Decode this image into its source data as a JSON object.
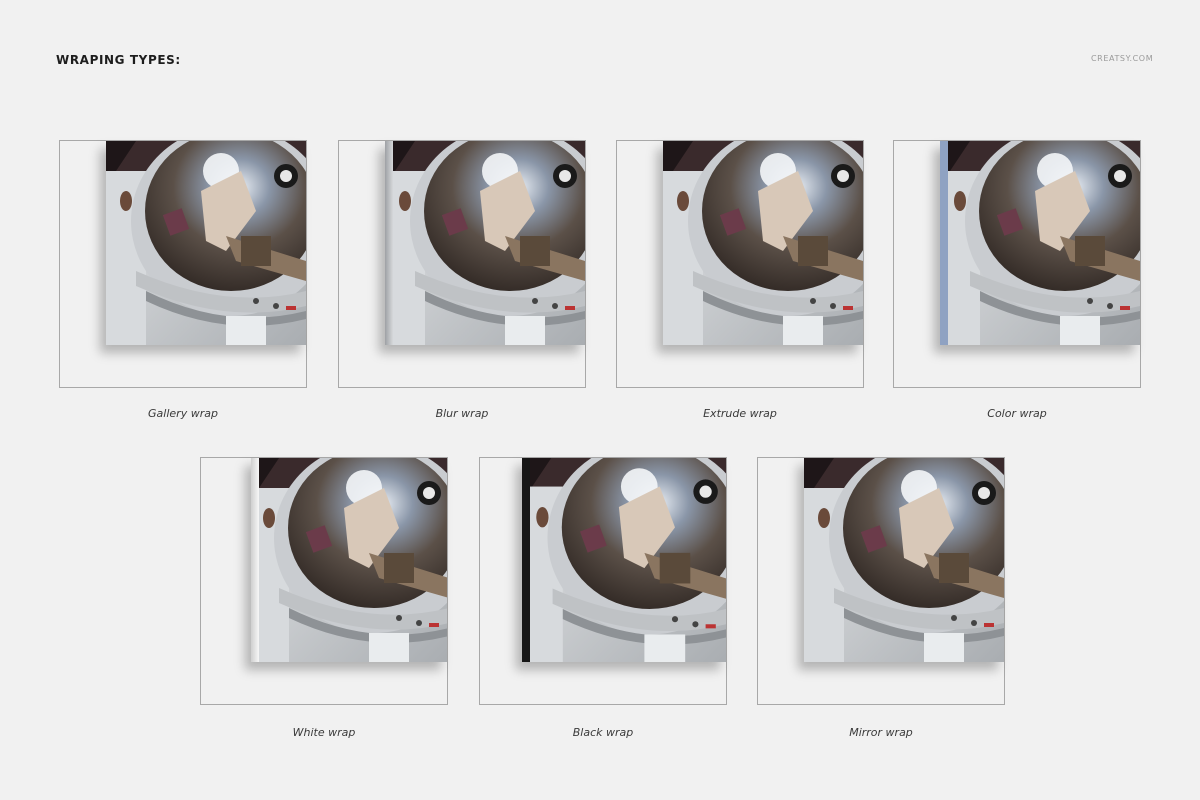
{
  "header": {
    "title": "WRAPING TYPES:",
    "brand": "CREATSY.COM"
  },
  "wraps": [
    {
      "label": "Gallery wrap",
      "edge_color": "#c9ccd0"
    },
    {
      "label": "Blur wrap",
      "edge_color": "#b8bbbf"
    },
    {
      "label": "Extrude wrap",
      "edge_color": "#2a2426"
    },
    {
      "label": "Color wrap",
      "edge_color": "#8fa2c2"
    },
    {
      "label": "White wrap",
      "edge_color": "#f4f4f4"
    },
    {
      "label": "Black wrap",
      "edge_color": "#161616"
    },
    {
      "label": "Mirror wrap",
      "edge_color": "#3b3034"
    }
  ]
}
